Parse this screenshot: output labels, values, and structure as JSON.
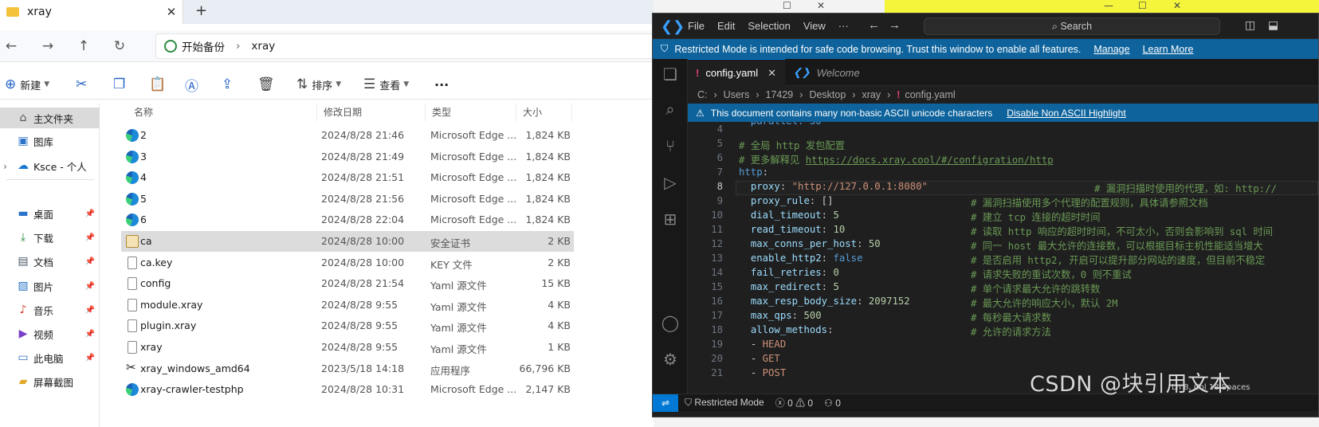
{
  "explorer": {
    "tab_title": "xray",
    "tab_close": "✕",
    "tab_add": "+",
    "breadcrumb": [
      "开始备份",
      "xray"
    ],
    "toolbar": {
      "new": "新建",
      "sort": "排序",
      "view": "查看",
      "more": "···"
    },
    "columns": {
      "name": "名称",
      "date": "修改日期",
      "type": "类型",
      "size": "大小"
    },
    "sidebar": [
      {
        "label": "主文件夹",
        "icon": "home-icon",
        "selected": true
      },
      {
        "label": "图库",
        "icon": "gallery-icon"
      },
      {
        "label": "Ksce - 个人",
        "icon": "cloud-icon"
      },
      {
        "label": "桌面",
        "icon": "desktop-icon"
      },
      {
        "label": "下载",
        "icon": "download-icon"
      },
      {
        "label": "文档",
        "icon": "documents-icon"
      },
      {
        "label": "图片",
        "icon": "pictures-icon"
      },
      {
        "label": "音乐",
        "icon": "music-icon"
      },
      {
        "label": "视频",
        "icon": "video-icon"
      },
      {
        "label": "此电脑",
        "icon": "pc-icon"
      },
      {
        "label": "屏幕截图",
        "icon": "folder-icon"
      }
    ],
    "files": [
      {
        "name": "2",
        "date": "2024/8/28 21:46",
        "type": "Microsoft Edge ...",
        "size": "1,824 KB",
        "icon": "edge-icon"
      },
      {
        "name": "3",
        "date": "2024/8/28 21:49",
        "type": "Microsoft Edge ...",
        "size": "1,824 KB",
        "icon": "edge-icon"
      },
      {
        "name": "4",
        "date": "2024/8/28 21:51",
        "type": "Microsoft Edge ...",
        "size": "1,824 KB",
        "icon": "edge-icon"
      },
      {
        "name": "5",
        "date": "2024/8/28 21:56",
        "type": "Microsoft Edge ...",
        "size": "1,824 KB",
        "icon": "edge-icon"
      },
      {
        "name": "6",
        "date": "2024/8/28 22:04",
        "type": "Microsoft Edge ...",
        "size": "1,824 KB",
        "icon": "edge-icon"
      },
      {
        "name": "ca",
        "date": "2024/8/28 10:00",
        "type": "安全证书",
        "size": "2 KB",
        "icon": "certificate-icon",
        "selected": true
      },
      {
        "name": "ca.key",
        "date": "2024/8/28 10:00",
        "type": "KEY 文件",
        "size": "2 KB",
        "icon": "file-icon"
      },
      {
        "name": "config",
        "date": "2024/8/28 21:54",
        "type": "Yaml 源文件",
        "size": "15 KB",
        "icon": "file-icon"
      },
      {
        "name": "module.xray",
        "date": "2024/8/28 9:55",
        "type": "Yaml 源文件",
        "size": "4 KB",
        "icon": "file-icon"
      },
      {
        "name": "plugin.xray",
        "date": "2024/8/28 9:55",
        "type": "Yaml 源文件",
        "size": "4 KB",
        "icon": "file-icon"
      },
      {
        "name": "xray",
        "date": "2024/8/28 9:55",
        "type": "Yaml 源文件",
        "size": "1 KB",
        "icon": "file-icon"
      },
      {
        "name": "xray_windows_amd64",
        "date": "2023/5/18 14:18",
        "type": "应用程序",
        "size": "66,796 KB",
        "icon": "app-icon"
      },
      {
        "name": "xray-crawler-testphp",
        "date": "2024/8/28 10:31",
        "type": "Microsoft Edge ...",
        "size": "2,147 KB",
        "icon": "edge-icon"
      }
    ]
  },
  "vscode": {
    "menu": [
      "File",
      "Edit",
      "Selection",
      "View",
      "···"
    ],
    "search": "Search",
    "banner": {
      "text": "Restricted Mode is intended for safe code browsing. Trust this window to enable all features.",
      "manage": "Manage",
      "learn_more": "Learn More"
    },
    "tabs": [
      {
        "label": "config.yaml",
        "close": "✕"
      },
      {
        "label": "Welcome"
      }
    ],
    "breadcrumb": [
      "C:",
      "Users",
      "17429",
      "Desktop",
      "xray",
      "config.yaml"
    ],
    "warning": {
      "text": "This document contains many non-basic ASCII unicode characters",
      "action": "Disable Non ASCII Highlight"
    },
    "lines": [
      {
        "n": "4",
        "code": "",
        "comment": ""
      },
      {
        "n": "5",
        "code": "# 全局 http 发包配置",
        "comment": ""
      },
      {
        "n": "6",
        "code": "# 更多解释见 https://docs.xray.cool/#/configration/http",
        "comment": ""
      },
      {
        "n": "7",
        "code": "http:",
        "comment": ""
      },
      {
        "n": "8",
        "code": "  proxy: \"http://127.0.0.1:8080\"",
        "comment": "# 漏洞扫描时使用的代理，如: http://"
      },
      {
        "n": "9",
        "code": "  proxy_rule: []",
        "comment": "# 漏洞扫描使用多个代理的配置规则，具体请参照文档"
      },
      {
        "n": "10",
        "code": "  dial_timeout: 5",
        "comment": "# 建立 tcp 连接的超时时间"
      },
      {
        "n": "11",
        "code": "  read_timeout: 10",
        "comment": "# 读取 http 响应的超时时间，不可太小，否则会影响到 sql 时间"
      },
      {
        "n": "12",
        "code": "  max_conns_per_host: 50",
        "comment": "# 同一 host 最大允许的连接数，可以根据目标主机性能适当增大"
      },
      {
        "n": "13",
        "code": "  enable_http2: false",
        "comment": "# 是否启用 http2, 开启可以提升部分网站的速度，但目前不稳定"
      },
      {
        "n": "14",
        "code": "  fail_retries: 0",
        "comment": "# 请求失败的重试次数，0 则不重试"
      },
      {
        "n": "15",
        "code": "  max_redirect: 5",
        "comment": "# 单个请求最大允许的跳转数"
      },
      {
        "n": "16",
        "code": "  max_resp_body_size: 2097152",
        "comment": "# 最大允许的响应大小，默认 2M"
      },
      {
        "n": "17",
        "code": "  max_qps: 500",
        "comment": "# 每秒最大请求数"
      },
      {
        "n": "18",
        "code": "  allow_methods:",
        "comment": "# 允许的请求方法"
      },
      {
        "n": "19",
        "code": "  - HEAD",
        "comment": ""
      },
      {
        "n": "20",
        "code": "  - GET",
        "comment": ""
      },
      {
        "n": "21",
        "code": "  - POST",
        "comment": ""
      }
    ],
    "current_line": "8",
    "status": {
      "mode": "Restricted Mode",
      "errors": "0",
      "warnings": "0",
      "ports": "0",
      "right": "Ln 8, Col 18  Spaces"
    }
  },
  "watermark": "CSDN @块引用文本"
}
